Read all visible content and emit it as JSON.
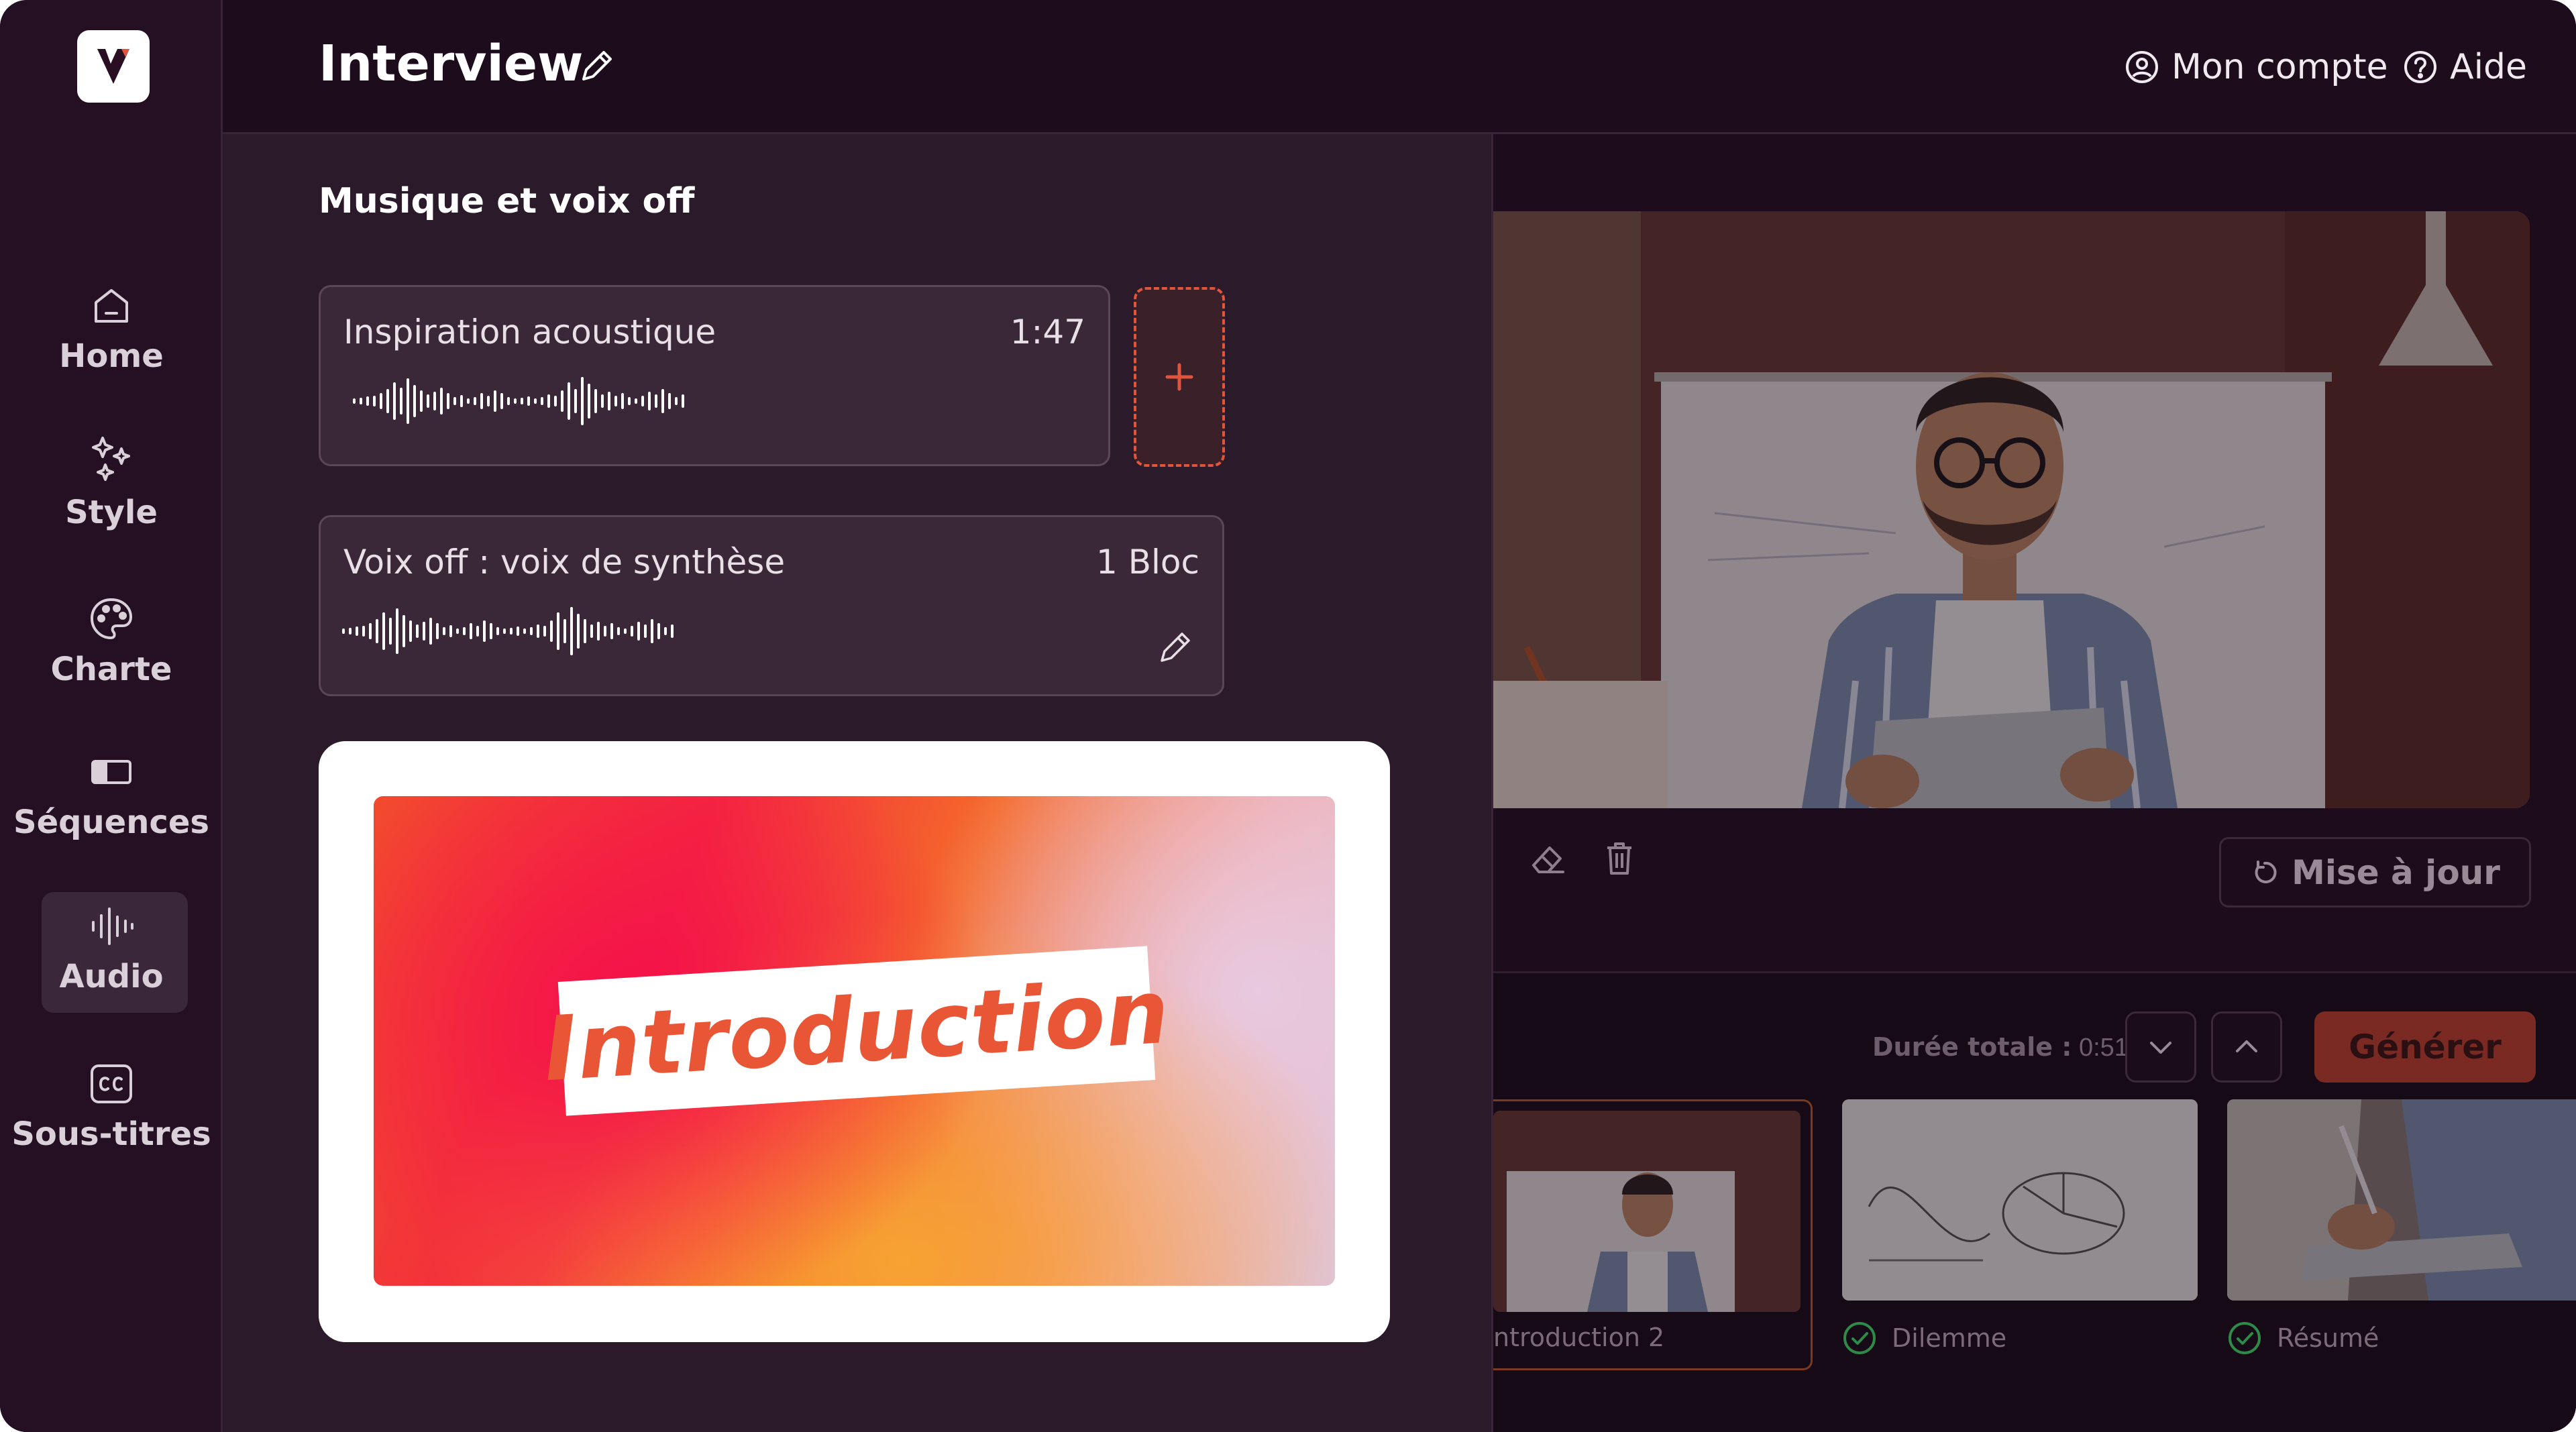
{
  "header": {
    "title": "Interview",
    "account_label": "Mon compte",
    "help_label": "Aide"
  },
  "sidebar": {
    "items": [
      {
        "label": "Home",
        "icon": "home-icon"
      },
      {
        "label": "Style",
        "icon": "sparkles-icon"
      },
      {
        "label": "Charte",
        "icon": "palette-icon"
      },
      {
        "label": "Séquences",
        "icon": "sequence-icon"
      },
      {
        "label": "Audio",
        "icon": "audio-wave-icon",
        "active": true
      },
      {
        "label": "Sous-titres",
        "icon": "subtitles-icon"
      }
    ]
  },
  "panel": {
    "title": "Musique et voix off",
    "music_track": {
      "name": "Inspiration acoustique",
      "duration": "1:47"
    },
    "voice_track": {
      "name": "Voix off : voix de synthèse",
      "blocks": "1 Bloc"
    },
    "preview_card": {
      "label": "Introduction"
    }
  },
  "preview": {
    "update_label": "Mise à jour"
  },
  "timeline": {
    "duration_label": "Durée totale :",
    "duration_value": "0:51",
    "generate_label": "Générer",
    "sequences": [
      {
        "label": "ntroduction 2",
        "checked": false
      },
      {
        "label": "Dilemme",
        "checked": true
      },
      {
        "label": "Résumé",
        "checked": true
      }
    ]
  },
  "colors": {
    "accent": "#e0553c",
    "background": "#1c0c1c",
    "panel": "#2b1a2a",
    "check_green": "#2f8a4a"
  }
}
